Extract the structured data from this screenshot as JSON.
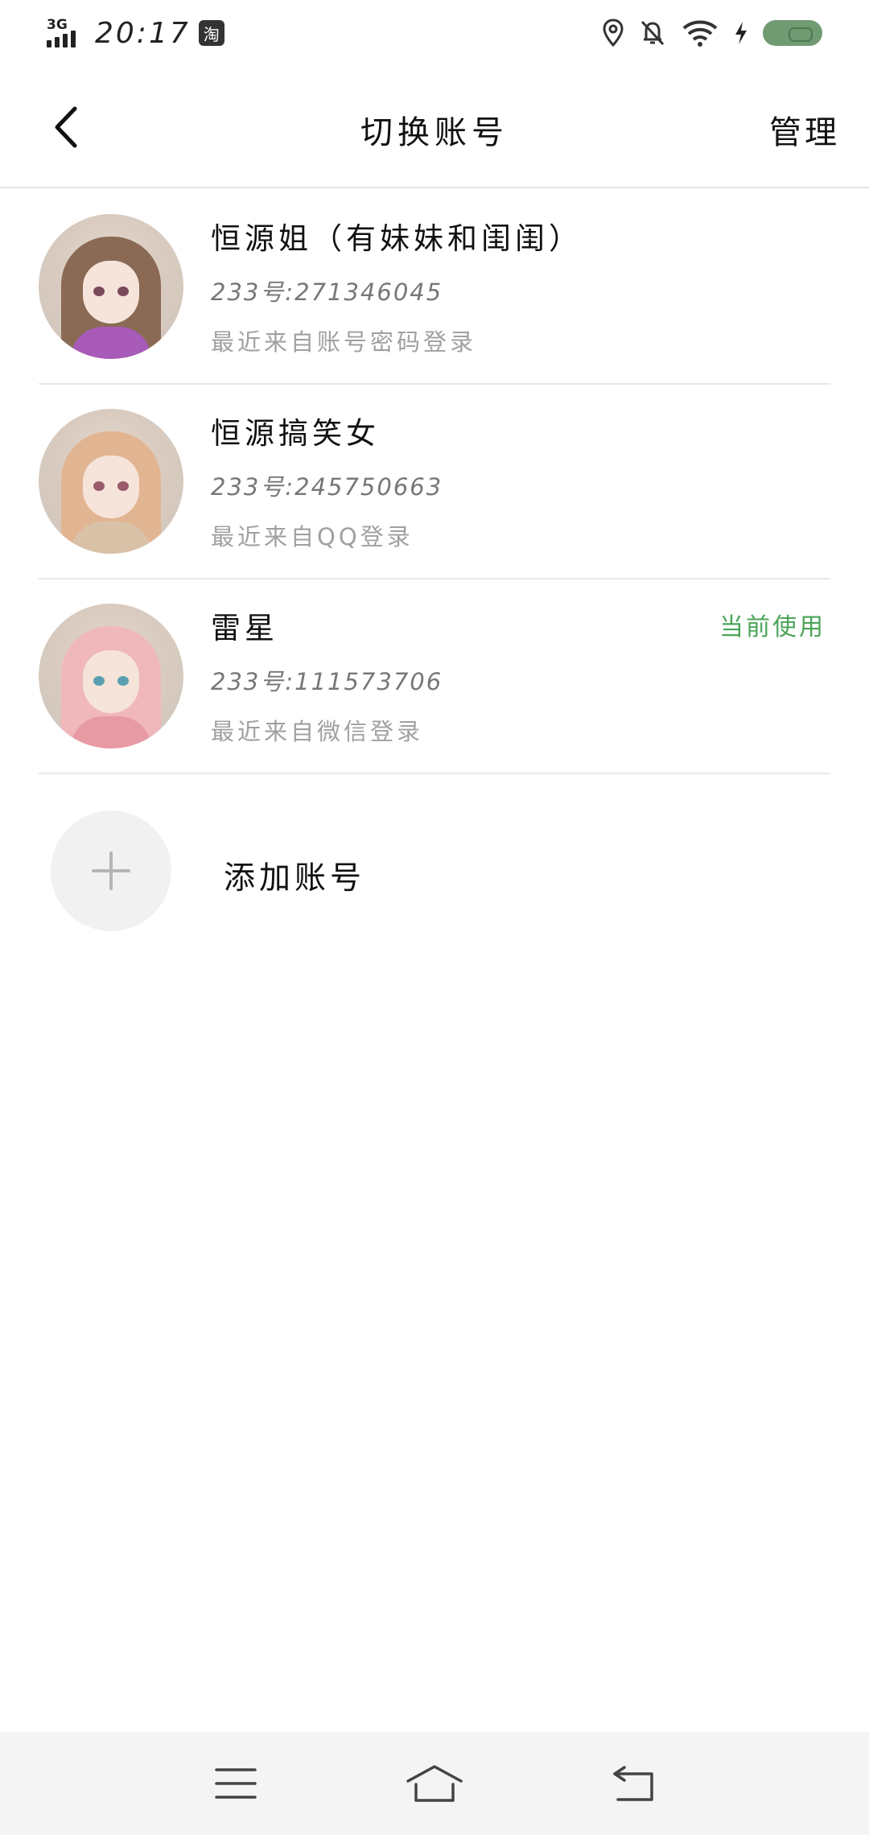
{
  "status_bar": {
    "network": "3G",
    "time": "20:17",
    "app_badge": "淘"
  },
  "header": {
    "title": "切换账号",
    "manage_label": "管理"
  },
  "accounts": [
    {
      "name": "恒源姐（有妹妹和闺闺）",
      "id_text": "233号:271346045",
      "source": "最近来自账号密码登录",
      "current_label": "",
      "hair_color": "#8a6a55",
      "eye_color": "#7a4a5a",
      "body_color": "#a85ab8"
    },
    {
      "name": "恒源搞笑女",
      "id_text": "233号:245750663",
      "source": "最近来自QQ登录",
      "current_label": "",
      "hair_color": "#e2b592",
      "eye_color": "#9a5a6a",
      "body_color": "#d9c2a8"
    },
    {
      "name": "雷星",
      "id_text": "233号:111573706",
      "source": "最近来自微信登录",
      "current_label": "当前使用",
      "hair_color": "#f0b8bc",
      "eye_color": "#5aa0b0",
      "body_color": "#e89aa4"
    }
  ],
  "add_account": {
    "label": "添加账号"
  },
  "colors": {
    "accent_green": "#4aa457",
    "divider": "#e8e8e8",
    "secondary_text": "#a0a0a0"
  }
}
